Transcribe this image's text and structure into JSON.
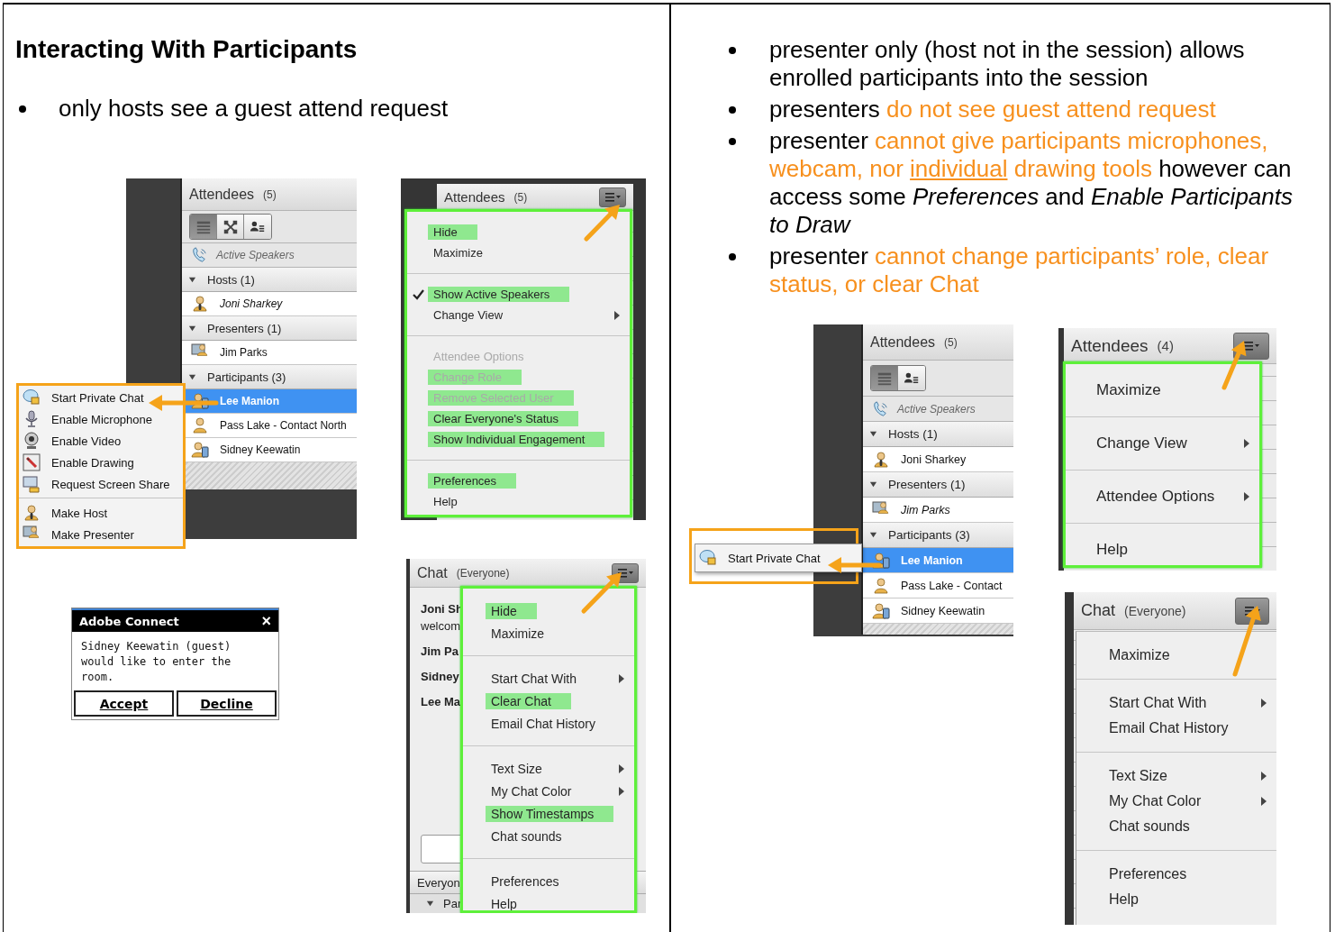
{
  "left": {
    "heading": "Interacting With Participants",
    "bullets": [
      {
        "text": "only hosts see a guest attend request"
      }
    ]
  },
  "host_attendees": {
    "title": "Attendees",
    "count": "(5)",
    "views": [
      {
        "kind": "list",
        "selected": true
      },
      {
        "kind": "graph",
        "selected": false
      },
      {
        "kind": "people",
        "selected": false
      }
    ],
    "active_speakers": "Active Speakers",
    "groups": [
      {
        "label": "Hosts (1)",
        "expanded": true,
        "members": [
          {
            "name": "Joni Sharkey",
            "kind": "host",
            "italic": true,
            "selected": false
          }
        ]
      },
      {
        "label": "Presenters (1)",
        "expanded": true,
        "members": [
          {
            "name": "Jim Parks",
            "kind": "presenter",
            "italic": false,
            "selected": false
          }
        ]
      },
      {
        "label": "Participants (3)",
        "expanded": true,
        "members": [
          {
            "name": "Lee Manion",
            "kind": "device",
            "italic": false,
            "selected": true
          },
          {
            "name": "Pass Lake - Contact North",
            "kind": "participant",
            "italic": false,
            "selected": false
          },
          {
            "name": "Sidney Keewatin",
            "kind": "device",
            "italic": false,
            "selected": false
          }
        ]
      }
    ],
    "context_menu": {
      "sections": [
        [
          {
            "label": "Start Private Chat"
          },
          {
            "label": "Enable Microphone"
          },
          {
            "label": "Enable Video"
          },
          {
            "label": "Enable Drawing"
          },
          {
            "label": "Request Screen Share"
          }
        ],
        [
          {
            "label": "Make Host"
          },
          {
            "label": "Make Presenter"
          }
        ]
      ]
    }
  },
  "host_pod_menu": {
    "title": "Attendees",
    "count": "(5)",
    "menu": {
      "sections": [
        [
          {
            "label": "Hide",
            "highlighted": true,
            "checked": false,
            "disabled": false,
            "submenu": false
          },
          {
            "label": "Maximize",
            "highlighted": false,
            "checked": false,
            "disabled": false,
            "submenu": false
          }
        ],
        [
          {
            "label": "Show Active Speakers",
            "highlighted": true,
            "checked": true,
            "disabled": false,
            "submenu": false
          },
          {
            "label": "Change View",
            "highlighted": false,
            "checked": false,
            "disabled": false,
            "submenu": true
          }
        ],
        [
          {
            "label": "Attendee Options",
            "highlighted": false,
            "checked": false,
            "disabled": true,
            "submenu": false
          },
          {
            "label": "Change Role",
            "highlighted": true,
            "checked": false,
            "disabled": true,
            "submenu": false
          },
          {
            "label": "Remove Selected User",
            "highlighted": true,
            "checked": false,
            "disabled": true,
            "submenu": false
          },
          {
            "label": "Clear Everyone's Status",
            "highlighted": true,
            "checked": false,
            "disabled": false,
            "submenu": false
          },
          {
            "label": "Show Individual Engagement",
            "highlighted": true,
            "checked": false,
            "disabled": false,
            "submenu": false
          }
        ],
        [
          {
            "label": "Preferences",
            "highlighted": true,
            "checked": false,
            "disabled": false,
            "submenu": false
          },
          {
            "label": "Help",
            "highlighted": false,
            "checked": false,
            "disabled": false,
            "submenu": false
          }
        ]
      ]
    }
  },
  "guest_request": {
    "title": "Adobe Connect",
    "close": "×",
    "message": "Sidney Keewatin (guest) would like to enter the room.",
    "buttons": [
      "Accept",
      "Decline"
    ]
  },
  "host_chat": {
    "title": "Chat",
    "scope": "(Everyone)",
    "lines": [
      {
        "text": "Joni Sh",
        "kind": "name"
      },
      {
        "text": "welcom",
        "kind": "message"
      },
      {
        "text": "Jim Pa",
        "kind": "name"
      },
      {
        "text": "Sidney",
        "kind": "name"
      },
      {
        "text": "Lee Ma",
        "kind": "name"
      }
    ],
    "footer": "Everyon",
    "section": "Par",
    "menu": {
      "sections": [
        [
          {
            "label": "Hide",
            "highlighted": true,
            "submenu": false
          },
          {
            "label": "Maximize",
            "highlighted": false,
            "submenu": false
          }
        ],
        [
          {
            "label": "Start Chat With",
            "highlighted": false,
            "submenu": true
          },
          {
            "label": "Clear Chat",
            "highlighted": true,
            "submenu": false
          },
          {
            "label": "Email Chat History",
            "highlighted": false,
            "submenu": false
          }
        ],
        [
          {
            "label": "Text Size",
            "highlighted": false,
            "submenu": true
          },
          {
            "label": "My Chat Color",
            "highlighted": false,
            "submenu": true
          },
          {
            "label": "Show Timestamps",
            "highlighted": true,
            "submenu": false
          },
          {
            "label": "Chat sounds",
            "highlighted": false,
            "submenu": false
          }
        ],
        [
          {
            "label": "Preferences",
            "highlighted": false,
            "submenu": false
          },
          {
            "label": "Help",
            "highlighted": false,
            "submenu": false
          }
        ]
      ]
    }
  },
  "right": {
    "bullets": [
      {
        "segments": [
          {
            "text": "presenter only (host not in the session) allows enrolled participants into the session",
            "kind": "plain"
          }
        ]
      },
      {
        "segments": [
          {
            "text": "presenters ",
            "kind": "plain"
          },
          {
            "text": "do not see guest attend request",
            "kind": "accent"
          }
        ]
      },
      {
        "segments": [
          {
            "text": "presenter ",
            "kind": "plain"
          },
          {
            "text": "cannot give participants microphones, webcam, nor ",
            "kind": "accent"
          },
          {
            "text": "individual",
            "kind": "underlined"
          },
          {
            "text": " drawing tools",
            "kind": "accent"
          },
          {
            "text": " however can access some ",
            "kind": "plain"
          },
          {
            "text": "Preferences",
            "kind": "emphasis"
          },
          {
            "text": " and ",
            "kind": "plain"
          },
          {
            "text": "Enable Participants to Draw",
            "kind": "emphasis"
          }
        ]
      },
      {
        "segments": [
          {
            "text": "presenter ",
            "kind": "plain"
          },
          {
            "text": "cannot change participants’ role, clear status, or clear Chat",
            "kind": "accent"
          }
        ]
      }
    ],
    "presenter_attendees": {
      "title": "Attendees",
      "count": "(5)",
      "views": [
        {
          "kind": "list",
          "selected": true
        },
        {
          "kind": "people",
          "selected": false
        }
      ],
      "active_speakers": "Active Speakers",
      "groups": [
        {
          "label": "Hosts (1)",
          "expanded": true,
          "members": [
            {
              "name": "Joni Sharkey",
              "kind": "host",
              "italic": false,
              "selected": false
            }
          ]
        },
        {
          "label": "Presenters (1)",
          "expanded": true,
          "members": [
            {
              "name": "Jim Parks",
              "kind": "presenter",
              "italic": true,
              "selected": false
            }
          ]
        },
        {
          "label": "Participants (3)",
          "expanded": true,
          "members": [
            {
              "name": "Lee Manion",
              "kind": "device",
              "italic": false,
              "selected": true
            },
            {
              "name": "Pass Lake - Contact",
              "kind": "participant",
              "italic": false,
              "selected": false
            },
            {
              "name": "Sidney Keewatin",
              "kind": "device",
              "italic": false,
              "selected": false
            }
          ]
        }
      ],
      "context_menu": {
        "sections": [
          [
            {
              "label": "Start Private Chat"
            }
          ]
        ]
      }
    },
    "presenter_pod_menu": {
      "title": "Attendees",
      "count": "(4)",
      "menu": {
        "sections": [
          [
            {
              "label": "Maximize",
              "submenu": false
            }
          ],
          [
            {
              "label": "Change View",
              "submenu": true
            }
          ],
          [
            {
              "label": "Attendee Options",
              "submenu": true
            }
          ],
          [
            {
              "label": "Help",
              "submenu": false
            }
          ]
        ]
      }
    },
    "presenter_chat": {
      "title": "Chat",
      "scope": "(Everyone)",
      "menu": {
        "sections": [
          [
            {
              "label": "Maximize",
              "submenu": false
            }
          ],
          [
            {
              "label": "Start Chat With",
              "submenu": true
            },
            {
              "label": "Email Chat History",
              "submenu": false
            }
          ],
          [
            {
              "label": "Text Size",
              "submenu": true
            },
            {
              "label": "My Chat Color",
              "submenu": true
            },
            {
              "label": "Chat sounds",
              "submenu": false
            }
          ],
          [
            {
              "label": "Preferences",
              "submenu": false
            },
            {
              "label": "Help",
              "submenu": false
            }
          ]
        ]
      }
    }
  }
}
